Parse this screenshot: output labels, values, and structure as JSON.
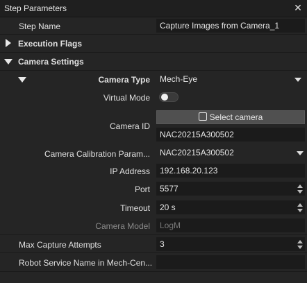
{
  "window": {
    "title": "Step Parameters",
    "close_icon": "close-icon"
  },
  "step_name": {
    "label": "Step Name",
    "value": "Capture Images from Camera_1"
  },
  "execution_flags": {
    "label": "Execution Flags"
  },
  "camera_settings": {
    "label": "Camera Settings",
    "camera_type": {
      "label": "Camera Type",
      "value": "Mech-Eye"
    },
    "virtual_mode": {
      "label": "Virtual Mode",
      "on": false
    },
    "camera_id": {
      "label": "Camera ID",
      "button": "Select camera",
      "value": "NAC20215A300502"
    },
    "calibration": {
      "label": "Camera Calibration Param...",
      "value": "NAC20215A300502"
    },
    "ip_address": {
      "label": "IP Address",
      "value": "192.168.20.123"
    },
    "port": {
      "label": "Port",
      "value": "5577"
    },
    "timeout": {
      "label": "Timeout",
      "value": "20 s"
    },
    "camera_model": {
      "label": "Camera Model",
      "value": "LogM"
    }
  },
  "max_capture": {
    "label": "Max Capture Attempts",
    "value": "3"
  },
  "robot_service": {
    "label": "Robot Service Name in Mech-Cen...",
    "value": ""
  },
  "colors": {
    "background": "#252525",
    "field": "#1b1b1b",
    "button": "#505050",
    "text": "#e0e0e0"
  }
}
